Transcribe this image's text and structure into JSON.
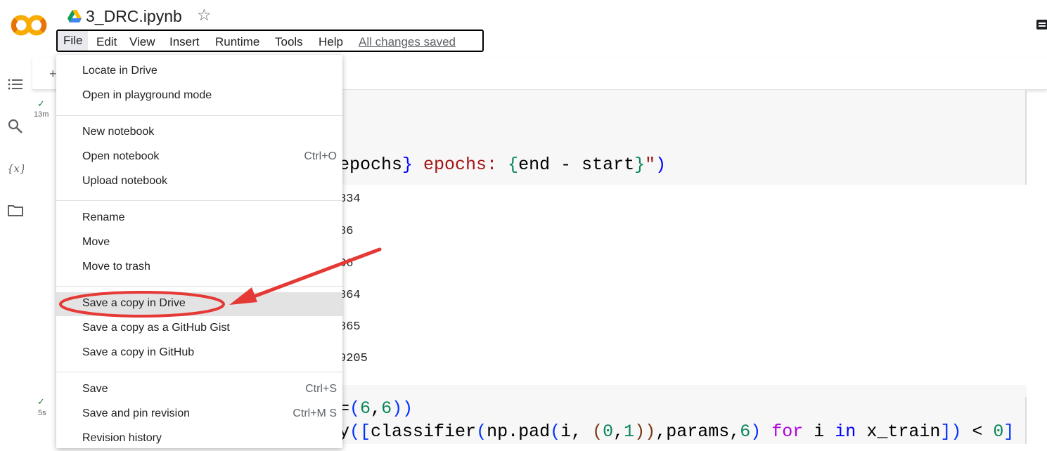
{
  "header": {
    "title": "3_DRC.ipynb",
    "star_icon": "star-icon",
    "logo_icon": "colab-logo",
    "drive_icon": "google-drive-icon"
  },
  "menubar": {
    "items": [
      "File",
      "Edit",
      "View",
      "Insert",
      "Runtime",
      "Tools",
      "Help"
    ],
    "status": "All changes saved"
  },
  "sidebar": {
    "icons": [
      "table-of-contents-icon",
      "search-icon",
      "variables-icon",
      "files-icon"
    ]
  },
  "cells": [
    {
      "status": "13m"
    },
    {
      "status": "5s"
    }
  ],
  "code1": {
    "line": {
      "a": "epochs",
      "b": "} ",
      "c": "epochs: ",
      "d": "{",
      "e": "end - start",
      "f": "}",
      "g": "\"",
      "h": ")"
    }
  },
  "output_lines": [
    "834",
    "86",
    "36",
    "864",
    "865",
    "9205"
  ],
  "code2": {
    "line1": {
      "a": "=",
      "b": "(",
      "c": "6",
      "d": ",",
      "e": "6",
      "f": "))"
    },
    "line2": {
      "a": "y",
      "b": "([",
      "c": "classifier",
      "d": "(",
      "e": "np.pad",
      "f": "(",
      "g": "i, ",
      "h": "(",
      "i": "0",
      "j": ",",
      "k": "1",
      "l": "))",
      "m": ",params,",
      "n": "6",
      "o": ") ",
      "p": "for",
      "q": " i ",
      "r": "in",
      "s": " x_train",
      "t": "])",
      "u": " < ",
      "v": "0",
      "w": "]"
    }
  },
  "file_menu": {
    "groups": [
      [
        {
          "label": "Locate in Drive",
          "shortcut": ""
        },
        {
          "label": "Open in playground mode",
          "shortcut": ""
        }
      ],
      [
        {
          "label": "New notebook",
          "shortcut": ""
        },
        {
          "label": "Open notebook",
          "shortcut": "Ctrl+O"
        },
        {
          "label": "Upload notebook",
          "shortcut": ""
        }
      ],
      [
        {
          "label": "Rename",
          "shortcut": ""
        },
        {
          "label": "Move",
          "shortcut": ""
        },
        {
          "label": "Move to trash",
          "shortcut": ""
        }
      ],
      [
        {
          "label": "Save a copy in Drive",
          "shortcut": ""
        },
        {
          "label": "Save a copy as a GitHub Gist",
          "shortcut": ""
        },
        {
          "label": "Save a copy in GitHub",
          "shortcut": ""
        }
      ],
      [
        {
          "label": "Save",
          "shortcut": "Ctrl+S"
        },
        {
          "label": "Save and pin revision",
          "shortcut": "Ctrl+M S"
        },
        {
          "label": "Revision history",
          "shortcut": ""
        }
      ]
    ],
    "highlighted": "Save a copy in Drive"
  },
  "annotation": {
    "color": "#e53935"
  }
}
